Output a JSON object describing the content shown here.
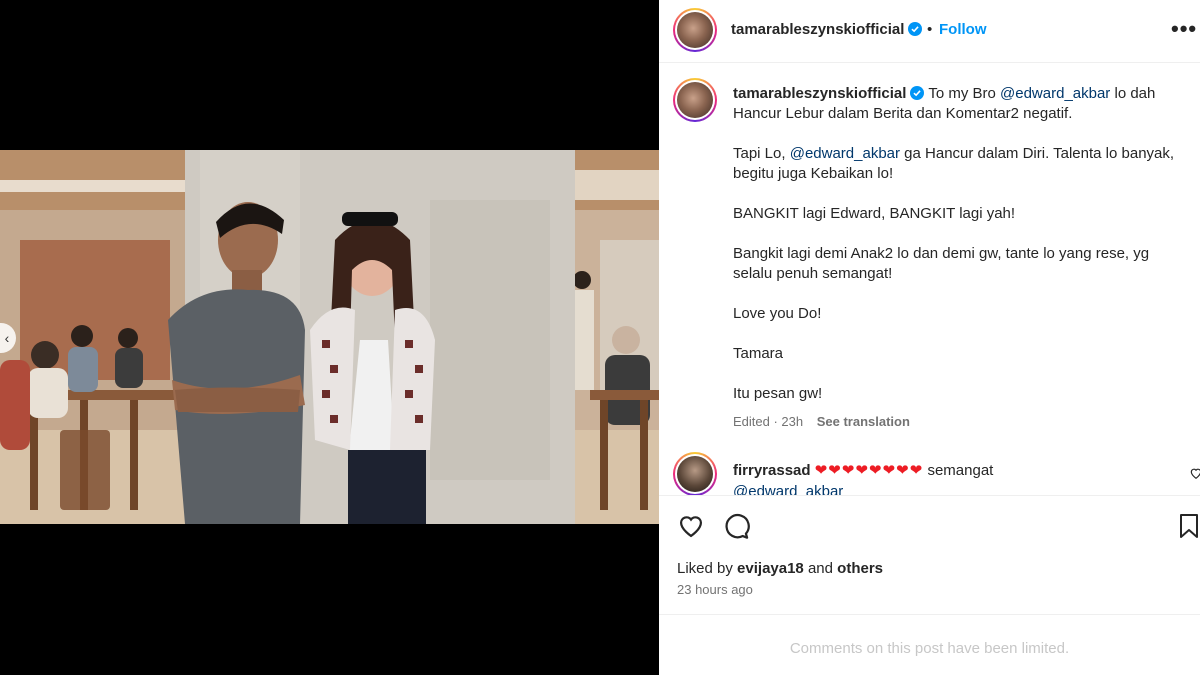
{
  "post": {
    "username": "tamarableszynskiofficial",
    "bullet": "•",
    "follow_label": "Follow",
    "more_icon": "more-options-icon",
    "more_label": "•••"
  },
  "caption": {
    "username": "tamarableszynskiofficial",
    "line1_pre": "To my Bro ",
    "line1_mention": "@edward_akbar",
    "line1_post": " lo dah Hancur Lebur dalam Berita dan Komentar2 negatif.",
    "p2_pre": "Tapi Lo, ",
    "p2_mention": "@edward_akbar",
    "p2_post": " ga Hancur dalam Diri. Talenta lo banyak, begitu juga Kebaikan lo!",
    "p3": "BANGKIT lagi Edward, BANGKIT lagi yah!",
    "p4": "Bangkit lagi demi Anak2 lo dan demi gw, tante lo yang rese, yg selalu penuh semangat!",
    "p5": "Love you Do!",
    "p6": "Tamara",
    "p7": "Itu pesan gw!",
    "edited": "Edited · 23h",
    "see_translation": "See translation"
  },
  "comment": {
    "username": "firryrassad",
    "hearts": "❤❤❤❤❤❤❤❤",
    "text": " semangat",
    "mention": "@edward_akbar"
  },
  "actions": {
    "liked_by_prefix": "Liked by ",
    "liked_by_user": "evijaya18",
    "liked_by_mid": " and ",
    "liked_by_others": "others",
    "time": "23 hours ago"
  },
  "footer": {
    "limited": "Comments on this post have been limited."
  },
  "carousel": {
    "total_slides": 4,
    "active_slide": 4,
    "prev_icon": "chevron-left-icon"
  },
  "colors": {
    "accent_blue": "#0095f6",
    "mention": "#00376b",
    "heart": "#ed1c24",
    "muted": "#737373"
  }
}
